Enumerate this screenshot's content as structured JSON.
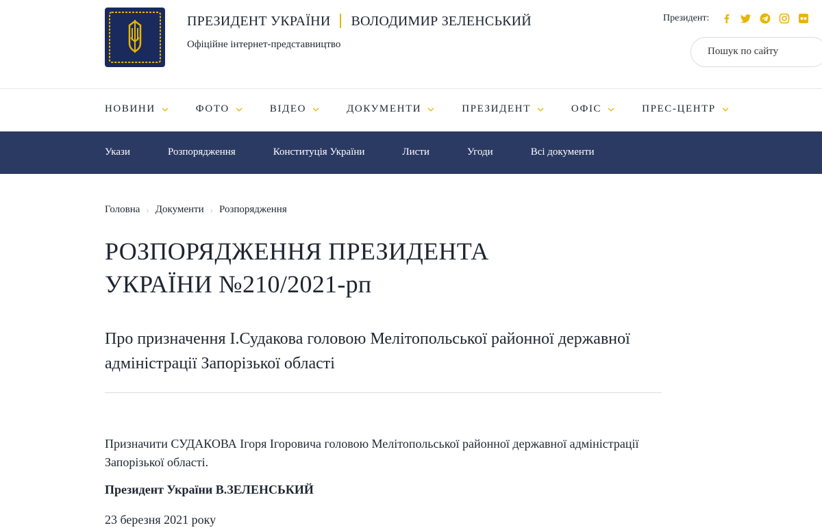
{
  "header": {
    "title_left": "ПРЕЗИДЕНТ УКРАЇНИ",
    "title_right": "ВОЛОДИМИР ЗЕЛЕНСЬКИЙ",
    "subtitle": "Офіційне інтернет-представництво",
    "social_label": "Президент:",
    "social_icons": [
      "facebook-icon",
      "twitter-icon",
      "telegram-icon",
      "instagram-icon",
      "flickr-icon"
    ],
    "search_placeholder": "Пошук по сайту"
  },
  "main_nav": [
    {
      "label": "НОВИНИ"
    },
    {
      "label": "ФОТО"
    },
    {
      "label": "ВІДЕО"
    },
    {
      "label": "ДОКУМЕНТИ"
    },
    {
      "label": "ПРЕЗИДЕНТ"
    },
    {
      "label": "ОФІС"
    },
    {
      "label": "ПРЕС-ЦЕНТР"
    }
  ],
  "sub_nav": [
    {
      "label": "Укази"
    },
    {
      "label": "Розпорядження"
    },
    {
      "label": "Конституція України"
    },
    {
      "label": "Листи"
    },
    {
      "label": "Угоди"
    },
    {
      "label": "Всі документи"
    }
  ],
  "breadcrumb": [
    "Головна",
    "Документи",
    "Розпорядження"
  ],
  "document": {
    "title": "РОЗПОРЯДЖЕННЯ ПРЕЗИДЕНТА УКРАЇНИ №210/2021-рп",
    "subtitle": "Про призначення І.Судакова головою Мелітопольської районної державної адміністрації Запорізької області",
    "body": "Призначити СУДАКОВА Ігоря Ігоровича головою Мелітопольської районної державної адміністрації Запорізької області.",
    "signature": "Президент України В.ЗЕЛЕНСЬКИЙ",
    "date": "23 березня 2021 року"
  },
  "colors": {
    "accent": "#e7b600",
    "navy": "#2b3a63",
    "logo_bg": "#1b2a5c",
    "text": "#1f2530"
  }
}
